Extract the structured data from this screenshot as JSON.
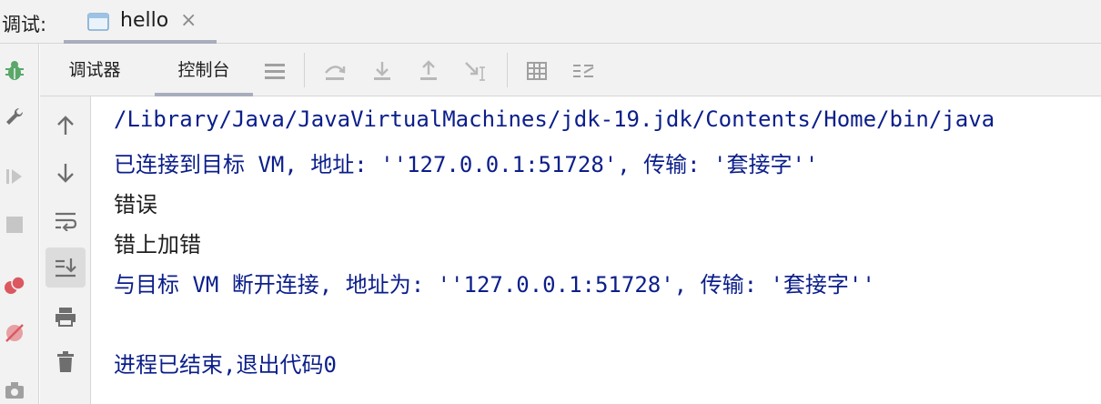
{
  "window": {
    "label": "调试:",
    "tab": {
      "title": "hello",
      "close_glyph": "×"
    }
  },
  "toolbar": {
    "tabs": [
      {
        "label": "调试器",
        "active": false
      },
      {
        "label": "控制台",
        "active": true
      }
    ],
    "icons": [
      "menu-icon",
      "step-over-icon",
      "step-into-icon",
      "step-out-icon",
      "run-to-cursor-icon",
      "evaluate-table-icon",
      "settings-list-icon"
    ]
  },
  "left_strip": {
    "icons": [
      "bug-icon",
      "wrench-icon",
      "resume-icon",
      "stop-icon",
      "breakpoints-icon",
      "mute-breakpoints-icon",
      "camera-icon"
    ]
  },
  "side_actions": {
    "icons": [
      "up-arrow-icon",
      "down-arrow-icon",
      "soft-wrap-icon",
      "scroll-to-end-icon",
      "print-icon",
      "trash-icon"
    ],
    "selected": "scroll-to-end-icon"
  },
  "console": {
    "lines": [
      {
        "text": "/Library/Java/JavaVirtualMachines/jdk-19.jdk/Contents/Home/bin/java",
        "color": "#0b1e8a"
      },
      {
        "text": "已连接到目标 VM, 地址: ''127.0.0.1:51728', 传输: '套接字''",
        "color": "#0b1e8a"
      },
      {
        "text": "错误",
        "color": "#1e1e1e"
      },
      {
        "text": "错上加错",
        "color": "#1e1e1e"
      },
      {
        "text": "与目标 VM 断开连接, 地址为: ''127.0.0.1:51728', 传输: '套接字''",
        "color": "#0b1e8a"
      },
      {
        "text": "",
        "color": "#0b1e8a"
      },
      {
        "text": "进程已结束,退出代码0",
        "color": "#0b1e8a"
      }
    ]
  },
  "colors": {
    "system_text": "#0b1e8a",
    "program_text": "#1e1e1e",
    "accent_underline": "#a8adbd",
    "icon_gray": "#6e6e6e",
    "bug_green": "#59a869",
    "breakpoint_red": "#db5860"
  }
}
